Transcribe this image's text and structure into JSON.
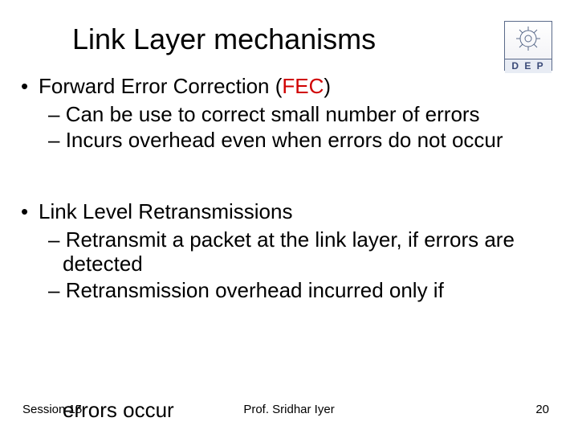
{
  "title": "Link Layer mechanisms",
  "logo": {
    "label": "D E P"
  },
  "bullets": {
    "b1_prefix": "Forward Error Correction  ",
    "b1_paren_open": "(",
    "b1_fec": "FEC",
    "b1_paren_close": ")",
    "b1_s1": "Can be use to correct small number of errors",
    "b1_s2": "Incurs overhead even when errors do not occur",
    "b2": "Link  Level Retransmissions",
    "b2_s1": "Retransmit a packet at the link layer, if errors are detected",
    "b2_s2": "Retransmission overhead incurred only if",
    "b2_s2_cont": "errors occur"
  },
  "footer": {
    "left": "Session 15",
    "center": "Prof. Sridhar Iyer",
    "right": "20"
  }
}
